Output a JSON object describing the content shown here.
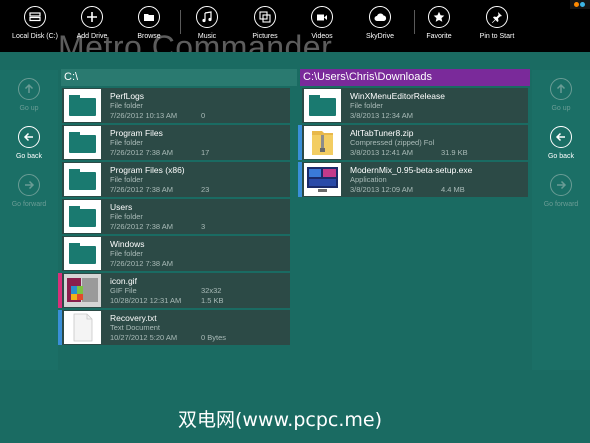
{
  "app": {
    "background_title": "Metro Commander"
  },
  "appbar": {
    "buttons": [
      {
        "label": "Local Disk (C:)",
        "icon": "drive-icon"
      },
      {
        "label": "Add Drive",
        "icon": "plus-icon"
      },
      {
        "label": "Browse",
        "icon": "folder-icon"
      },
      {
        "label": "Music",
        "icon": "music-note-icon"
      },
      {
        "label": "Pictures",
        "icon": "pictures-icon"
      },
      {
        "label": "Videos",
        "icon": "video-camera-icon"
      },
      {
        "label": "SkyDrive",
        "icon": "cloud-icon"
      },
      {
        "label": "Favorite",
        "icon": "star-icon"
      },
      {
        "label": "Pin to Start",
        "icon": "pin-icon"
      }
    ]
  },
  "left_nav": {
    "up": "Go up",
    "back": "Go back",
    "forward": "Go forward"
  },
  "right_nav": {
    "up": "Go up",
    "back": "Go back",
    "forward": "Go forward"
  },
  "left_pane": {
    "path": "C:\\",
    "items": [
      {
        "name": "PerfLogs",
        "type": "File folder",
        "date": "7/26/2012 10:13 AM",
        "extra": "0",
        "dims": ""
      },
      {
        "name": "Program Files",
        "type": "File folder",
        "date": "7/26/2012 7:38 AM",
        "extra": "17",
        "dims": ""
      },
      {
        "name": "Program Files (x86)",
        "type": "File folder",
        "date": "7/26/2012 7:38 AM",
        "extra": "23",
        "dims": ""
      },
      {
        "name": "Users",
        "type": "File folder",
        "date": "7/26/2012 7:38 AM",
        "extra": "3",
        "dims": ""
      },
      {
        "name": "Windows",
        "type": "File folder",
        "date": "7/26/2012 7:38 AM",
        "extra": "",
        "dims": ""
      },
      {
        "name": "icon.gif",
        "type": "GIF File",
        "date": "10/28/2012 12:31 AM",
        "extra": "1.5 KB",
        "dims": "32x32"
      },
      {
        "name": "Recovery.txt",
        "type": "Text Document",
        "date": "10/27/2012 5:20 AM",
        "extra": "0 Bytes",
        "dims": ""
      }
    ]
  },
  "right_pane": {
    "path": "C:\\Users\\Chris\\Downloads",
    "items": [
      {
        "name": "WinXMenuEditorRelease",
        "type": "File folder",
        "date": "3/8/2013 12:34 AM",
        "extra": ""
      },
      {
        "name": "AltTabTuner8.zip",
        "type": "Compressed (zipped) Fol",
        "date": "3/8/2013 12:41 AM",
        "extra": "31.9 KB"
      },
      {
        "name": "ModernMix_0.95-beta-setup.exe",
        "type": "Application",
        "date": "3/8/2013 12:09 AM",
        "extra": "4.4 MB"
      }
    ]
  },
  "watermark": "双电网(www.pcpc.me)",
  "colors": {
    "background": "#1a6b62",
    "appbar": "#000000",
    "left_path": "#2a7a70",
    "right_path": "#7a2a9a",
    "row": "#2c4a46",
    "selection": "#3a8fd8"
  }
}
